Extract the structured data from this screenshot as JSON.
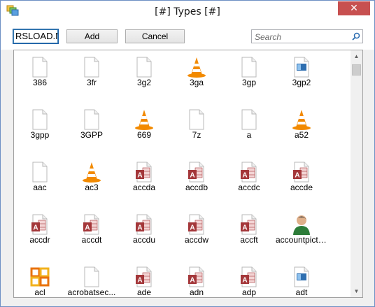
{
  "window": {
    "title": "[#] Types [#]",
    "close_glyph": "✕"
  },
  "toolbar": {
    "input_value": "RSLOAD.NET",
    "add_label": "Add",
    "cancel_label": "Cancel",
    "search_placeholder": "Search"
  },
  "items": [
    {
      "label": "386",
      "icon": "blank-file-icon"
    },
    {
      "label": "3fr",
      "icon": "blank-file-icon"
    },
    {
      "label": "3g2",
      "icon": "blank-file-icon"
    },
    {
      "label": "3ga",
      "icon": "vlc-cone-icon"
    },
    {
      "label": "3gp",
      "icon": "blank-file-icon"
    },
    {
      "label": "3gp2",
      "icon": "media-file-icon"
    },
    {
      "label": "3gpp",
      "icon": "blank-file-icon"
    },
    {
      "label": "3GPP",
      "icon": "blank-file-icon"
    },
    {
      "label": "669",
      "icon": "vlc-cone-icon"
    },
    {
      "label": "7z",
      "icon": "blank-file-icon"
    },
    {
      "label": "a",
      "icon": "blank-file-icon"
    },
    {
      "label": "a52",
      "icon": "vlc-cone-icon"
    },
    {
      "label": "aac",
      "icon": "blank-file-icon"
    },
    {
      "label": "ac3",
      "icon": "vlc-cone-icon"
    },
    {
      "label": "accda",
      "icon": "access-db-icon"
    },
    {
      "label": "accdb",
      "icon": "access-db-icon"
    },
    {
      "label": "accdc",
      "icon": "access-db-icon"
    },
    {
      "label": "accde",
      "icon": "access-db-icon"
    },
    {
      "label": "accdr",
      "icon": "access-db-icon"
    },
    {
      "label": "accdt",
      "icon": "access-db-icon"
    },
    {
      "label": "accdu",
      "icon": "access-db-icon"
    },
    {
      "label": "accdw",
      "icon": "access-db-icon"
    },
    {
      "label": "accft",
      "icon": "access-db-icon"
    },
    {
      "label": "accountpictu...",
      "icon": "user-avatar-icon"
    },
    {
      "label": "acl",
      "icon": "office-grid-icon"
    },
    {
      "label": "acrobatsec...",
      "icon": "blank-file-icon"
    },
    {
      "label": "ade",
      "icon": "access-db-icon"
    },
    {
      "label": "adn",
      "icon": "access-db-icon"
    },
    {
      "label": "adp",
      "icon": "access-db-icon"
    },
    {
      "label": "adt",
      "icon": "media-file-icon"
    }
  ],
  "colors": {
    "access_red": "#a4373a",
    "vlc_orange": "#f28a00",
    "office_orange": "#e8720c",
    "media_blue": "#2f6fb0"
  }
}
